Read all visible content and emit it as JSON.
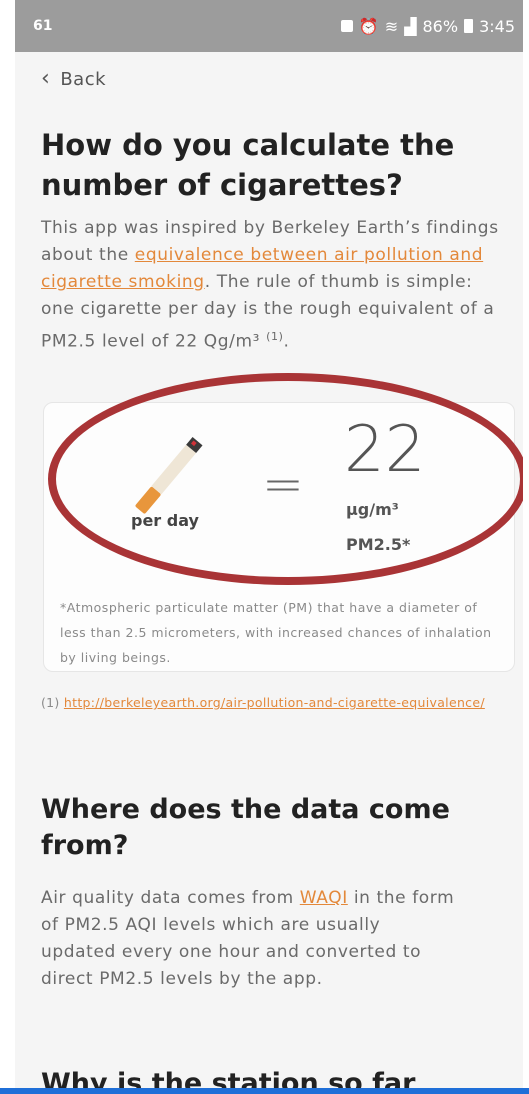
{
  "status_bar": {
    "left_text": "61",
    "battery_pct": "86%",
    "time": "3:45"
  },
  "nav": {
    "back_label": "Back"
  },
  "section1": {
    "title": "How do you calculate the number of cigarettes?",
    "para_part1": "This app was inspired by Berkeley Earth’s findings about the ",
    "link_text": "equivalence between air pollution and cigarette smoking",
    "para_part2": ". The rule of thumb is simple: one cigarette per day is the rough equivalent of a PM2.5 level of 22 Qg/m³ ",
    "para_sup": "(1)",
    "para_end": "."
  },
  "card": {
    "per_day": "per day",
    "equals": "=",
    "value": "22",
    "unit": "µg/m³",
    "pollutant": "PM2.5*",
    "footnote": "*Atmospheric particulate matter (PM) that have a diameter of less than 2.5 micrometers, with increased chances of inhalation by living beings."
  },
  "reference": {
    "number": "(1)",
    "url": "http://berkeleyearth.org/air-pollution-and-cigarette-equivalence/"
  },
  "section2": {
    "title": "Where does the data come from?",
    "para_part1": "Air quality data comes from ",
    "link_text": "WAQI",
    "para_part2": " in the form of PM2.5 AQI levels which are usually updated every one hour and converted to direct PM2.5 levels by the app."
  },
  "section3": {
    "title": "Why is the station so far"
  },
  "colors": {
    "accent": "#e3883a",
    "highlight_ring": "#a93436",
    "status_bar": "#9c9c9c"
  }
}
